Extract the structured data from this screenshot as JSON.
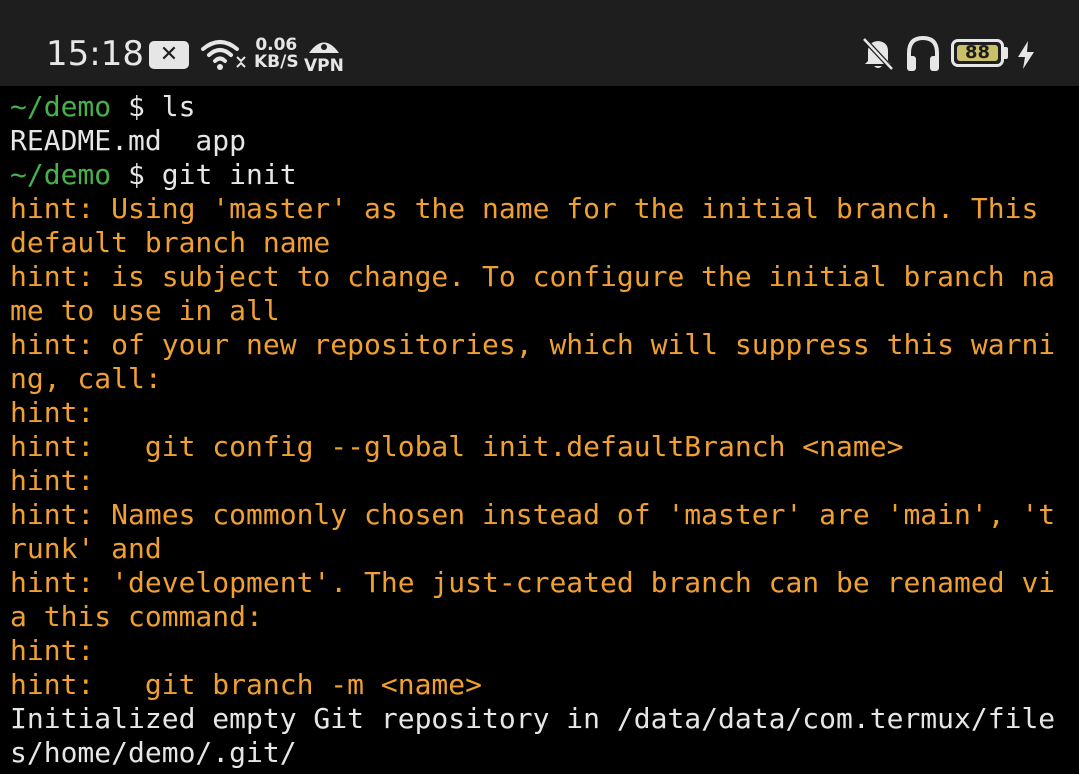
{
  "status_bar": {
    "time": "15:18",
    "notification_icon": "close-box-icon",
    "network_speed_value": "0.06",
    "network_speed_unit": "KB/S",
    "vpn_label": "VPN",
    "battery_level": "88",
    "icons": [
      "wifi-icon",
      "vpn-key-icon",
      "mute-icon",
      "headphones-icon",
      "battery-icon",
      "charging-bolt-icon"
    ]
  },
  "terminal": {
    "colors": {
      "path": "#45b24a",
      "hint": "#f0a030",
      "text": "#e6e6e6",
      "background": "#000000"
    },
    "lines": [
      {
        "type": "prompt",
        "path": "~/demo",
        "symbol": " $ ",
        "command": "ls"
      },
      {
        "type": "out",
        "text": "README.md  app"
      },
      {
        "type": "prompt",
        "path": "~/demo",
        "symbol": " $ ",
        "command": "git init"
      },
      {
        "type": "hint",
        "text": "hint: Using 'master' as the name for the initial branch. This"
      },
      {
        "type": "hint",
        "text": "default branch name"
      },
      {
        "type": "hint",
        "text": "hint: is subject to change. To configure the initial branch na"
      },
      {
        "type": "hint",
        "text": "me to use in all"
      },
      {
        "type": "hint",
        "text": "hint: of your new repositories, which will suppress this warni"
      },
      {
        "type": "hint",
        "text": "ng, call:"
      },
      {
        "type": "hint",
        "text": "hint:"
      },
      {
        "type": "hint",
        "text": "hint:   git config --global init.defaultBranch <name>"
      },
      {
        "type": "hint",
        "text": "hint:"
      },
      {
        "type": "hint",
        "text": "hint: Names commonly chosen instead of 'master' are 'main', 't"
      },
      {
        "type": "hint",
        "text": "runk' and"
      },
      {
        "type": "hint",
        "text": "hint: 'development'. The just-created branch can be renamed vi"
      },
      {
        "type": "hint",
        "text": "a this command:"
      },
      {
        "type": "hint",
        "text": "hint:"
      },
      {
        "type": "hint",
        "text": "hint:   git branch -m <name>"
      },
      {
        "type": "out",
        "text": "Initialized empty Git repository in /data/data/com.termux/file"
      },
      {
        "type": "out",
        "text": "s/home/demo/.git/"
      }
    ]
  }
}
